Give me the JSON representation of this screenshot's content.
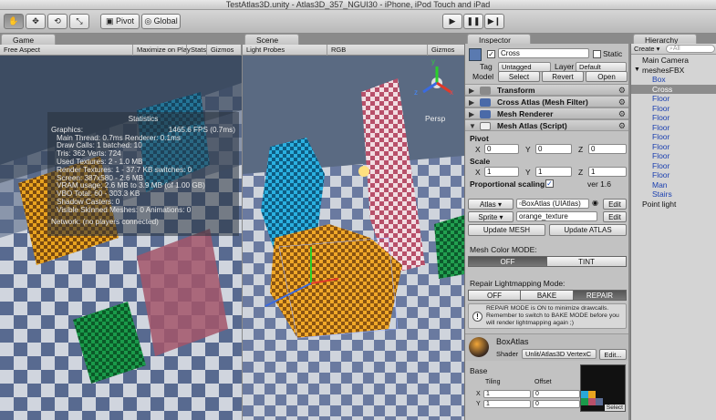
{
  "window": {
    "title": "TestAtlas3D.unity - Atlas3D_357_NGUI30 - iPhone, iPod Touch and iPad"
  },
  "toolbar": {
    "pivot_label": "Pivot",
    "global_label": "Global",
    "tools": [
      "hand-icon",
      "move-icon",
      "rotate-icon",
      "scale-icon"
    ],
    "play_icons": [
      "play-icon",
      "pause-icon",
      "step-icon"
    ]
  },
  "game": {
    "tab_label": "Game",
    "aspect_label": "Free Aspect",
    "maximize_label": "Maximize on Play",
    "stats_label": "Stats",
    "gizmos_label": "Gizmos",
    "stats": {
      "title": "Statistics",
      "graphics_label": "Graphics:",
      "fps": "1465.6 FPS (0.7ms)",
      "lines": [
        "Main Thread: 0.7ms  Renderer: 0.1ms",
        "Draw Calls: 1  batched: 10",
        "Tris: 362    Verts: 724",
        "Used Textures: 2 - 1.0 MB",
        "Render Textures: 1 - 37.7 KB    switches: 0",
        "Screen: 387x580 - 2.6 MB",
        "VRAM usage: 2.6 MB to 3.9 MB (of 1.00 GB)",
        "VBO Total: 60 - 303.3 KB",
        "Shadow Casters: 0",
        "Visible Skinned Meshes: 0      Animations: 0"
      ],
      "network": "Network: (no players connected)"
    }
  },
  "scene": {
    "tab_label": "Scene",
    "mode_label": "Light Probes",
    "rgb_label": "RGB",
    "gizmos_label": "Gizmos",
    "persp_label": "Persp",
    "axis_labels": {
      "y": "y",
      "x": "x",
      "z": "z"
    }
  },
  "inspector": {
    "tab_label": "Inspector",
    "object_name": "Cross",
    "static_label": "Static",
    "tag_label": "Tag",
    "tag_value": "Untagged",
    "layer_label": "Layer",
    "layer_value": "Default",
    "model_label": "Model",
    "select_label": "Select",
    "revert_label": "Revert",
    "open_label": "Open",
    "components": [
      "Transform",
      "Cross Atlas (Mesh Filter)",
      "Mesh Renderer",
      "Mesh Atlas (Script)"
    ],
    "pivot": {
      "label": "Pivot",
      "x": "0",
      "y": "0",
      "z": "0"
    },
    "scale": {
      "label": "Scale",
      "x": "1",
      "y": "1",
      "z": "1"
    },
    "axis": {
      "x": "X",
      "y": "Y",
      "z": "Z"
    },
    "proportional_label": "Proportional scaling",
    "version": "ver 1.6",
    "atlas_label": "Atlas",
    "atlas_value": "BoxAtlas (UIAtlas)",
    "edit_label": "Edit",
    "sprite_label": "Sprite",
    "sprite_value": "orange_texture",
    "update_mesh": "Update MESH",
    "update_atlas": "Update ATLAS",
    "color_mode_label": "Mesh Color MODE:",
    "color_off": "OFF",
    "color_tint": "TINT",
    "repair_mode_label": "Repair Lightmapping Mode:",
    "repair_off": "OFF",
    "repair_bake": "BAKE",
    "repair_repair": "REPAIR",
    "info_text": "REPAIR MODE is ON to minimize drawcalls. Remember to switch to BAKE MODE before you will render lightmapping again ;)",
    "material_name": "BoxAtlas",
    "shader_label": "Shader",
    "shader_value": "Unlit/Atlas3D VertexC",
    "shader_edit": "Edit...",
    "base_label": "Base",
    "tiling_label": "Tiling",
    "offset_label": "Offset",
    "tiling_x": "1",
    "tiling_y": "1",
    "offset_x": "0",
    "offset_y": "0",
    "tex_select": "Select"
  },
  "hierarchy": {
    "tab_label": "Hierarchy",
    "create_label": "Create",
    "search_placeholder": "All",
    "items": [
      {
        "label": "Main Camera",
        "level": 0,
        "selected": false
      },
      {
        "label": "meshesFBX",
        "level": 0,
        "selected": false
      },
      {
        "label": "Box",
        "level": 1,
        "selected": false
      },
      {
        "label": "Cross",
        "level": 1,
        "selected": true
      },
      {
        "label": "Floor",
        "level": 1,
        "selected": false
      },
      {
        "label": "Floor",
        "level": 1,
        "selected": false
      },
      {
        "label": "Floor",
        "level": 1,
        "selected": false
      },
      {
        "label": "Floor",
        "level": 1,
        "selected": false
      },
      {
        "label": "Floor",
        "level": 1,
        "selected": false
      },
      {
        "label": "Floor",
        "level": 1,
        "selected": false
      },
      {
        "label": "Floor",
        "level": 1,
        "selected": false
      },
      {
        "label": "Floor",
        "level": 1,
        "selected": false
      },
      {
        "label": "Floor",
        "level": 1,
        "selected": false
      },
      {
        "label": "Man",
        "level": 1,
        "selected": false
      },
      {
        "label": "Stairs",
        "level": 1,
        "selected": false
      },
      {
        "label": "Point light",
        "level": 0,
        "selected": false
      }
    ]
  }
}
